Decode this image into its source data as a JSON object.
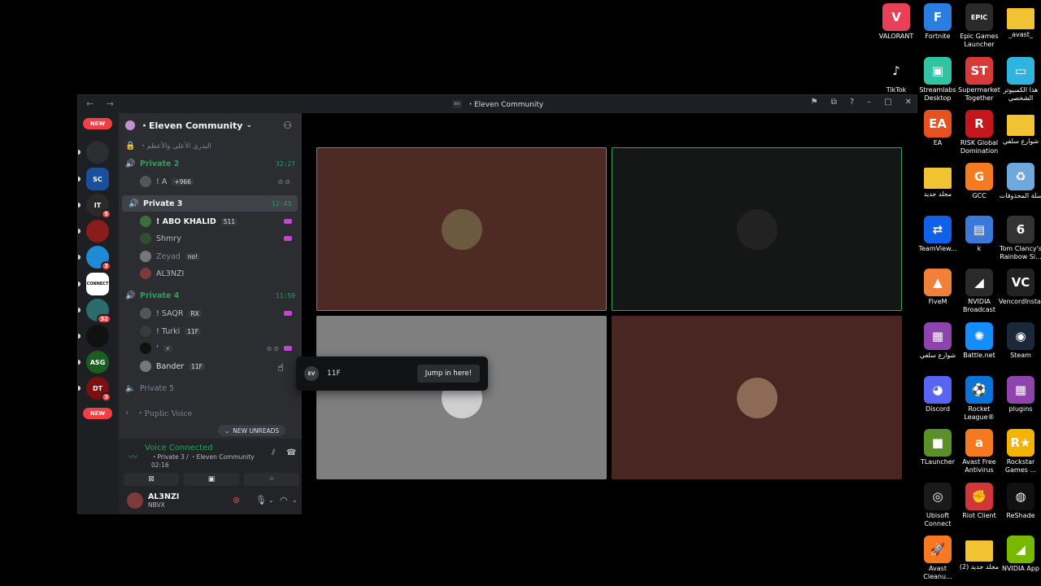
{
  "desktop": {
    "icons": [
      {
        "label": "VALORANT",
        "icon": "valorant-icon",
        "color": "#e84057",
        "glyph": "V"
      },
      {
        "label": "Fortnite",
        "icon": "fortnite-icon",
        "color": "#2a7de1",
        "glyph": "F"
      },
      {
        "label": "Epic Games Launcher",
        "icon": "epic-games-icon",
        "color": "#2a2a2a",
        "glyph": "EPIC"
      },
      {
        "label": "_avast_",
        "icon": "folder-icon",
        "color": "#f1c232",
        "glyph": ""
      },
      {
        "label": "TikTok",
        "icon": "tiktok-icon",
        "color": "#000000",
        "glyph": "♪"
      },
      {
        "label": "Streamlabs Desktop",
        "icon": "streamlabs-icon",
        "color": "#31c3a2",
        "glyph": "▣"
      },
      {
        "label": "Supermarket Together",
        "icon": "supermarket-icon",
        "color": "#d83a3a",
        "glyph": "ST"
      },
      {
        "label": "هذا الكمبيوتر الشخصي",
        "icon": "computer-icon",
        "color": "#2fb4e0",
        "glyph": "▭"
      },
      {
        "label": "EA",
        "icon": "ea-icon",
        "color": "#e85020",
        "glyph": "EA"
      },
      {
        "label": "RISK Global Domination",
        "icon": "risk-icon",
        "color": "#c4161c",
        "glyph": "R"
      },
      {
        "label": "شوارع سلفي",
        "icon": "folder-icon",
        "color": "#f1c232",
        "glyph": ""
      },
      {
        "label": "مجلد جديد",
        "icon": "folder-icon",
        "color": "#f1c232",
        "glyph": ""
      },
      {
        "label": "GCC",
        "icon": "gcc-icon",
        "color": "#f47b20",
        "glyph": "G"
      },
      {
        "label": "سلة المحذوفات",
        "icon": "recycle-bin-icon",
        "color": "#6fa8dc",
        "glyph": "♻"
      },
      {
        "label": "TeamView...",
        "icon": "teamviewer-icon",
        "color": "#1061e8",
        "glyph": "⇄"
      },
      {
        "label": "k",
        "icon": "file-icon",
        "color": "#3c78d8",
        "glyph": "▤"
      },
      {
        "label": "Tom Clancy's Rainbow Si...",
        "icon": "rainbow-six-icon",
        "color": "#333333",
        "glyph": "6"
      },
      {
        "label": "FiveM",
        "icon": "fivem-icon",
        "color": "#f0803a",
        "glyph": "▲"
      },
      {
        "label": "NVIDIA Broadcast",
        "icon": "nvidia-broadcast-icon",
        "color": "#2a2a2a",
        "glyph": "◢"
      },
      {
        "label": "VencordInstal",
        "icon": "vencord-icon",
        "color": "#222222",
        "glyph": "VC"
      },
      {
        "label": "شوارع سلفي",
        "icon": "winrar-icon",
        "color": "#8e44ad",
        "glyph": "▦"
      },
      {
        "label": "Battle.net",
        "icon": "battlenet-icon",
        "color": "#148eff",
        "glyph": "✺"
      },
      {
        "label": "Steam",
        "icon": "steam-icon",
        "color": "#1b2838",
        "glyph": "◉"
      },
      {
        "label": "Discord",
        "icon": "discord-icon",
        "color": "#5865f2",
        "glyph": "◕"
      },
      {
        "label": "Rocket League®",
        "icon": "rocket-league-icon",
        "color": "#0a74da",
        "glyph": "⚽"
      },
      {
        "label": "plugins",
        "icon": "winrar-icon",
        "color": "#8e44ad",
        "glyph": "▦"
      },
      {
        "label": "TLauncher",
        "icon": "tlauncher-icon",
        "color": "#5a8f29",
        "glyph": "■"
      },
      {
        "label": "Avast Free Antivirus",
        "icon": "avast-icon",
        "color": "#f47920",
        "glyph": "a"
      },
      {
        "label": "Rockstar Games ...",
        "icon": "rockstar-icon",
        "color": "#f5b301",
        "glyph": "R★"
      },
      {
        "label": "Ubisoft Connect",
        "icon": "ubisoft-icon",
        "color": "#1a1a1a",
        "glyph": "◎"
      },
      {
        "label": "Riot Client",
        "icon": "riot-icon",
        "color": "#d13639",
        "glyph": "✊"
      },
      {
        "label": "ReShade",
        "icon": "reshade-icon",
        "color": "#111111",
        "glyph": "◍"
      },
      {
        "label": "Avast Cleanu...",
        "icon": "avast-cleanup-icon",
        "color": "#f47920",
        "glyph": "🚀"
      },
      {
        "label": "مجلد جديد (2)",
        "icon": "folder-icon",
        "color": "#f1c232",
        "glyph": ""
      },
      {
        "label": "NVIDIA App",
        "icon": "nvidia-app-icon",
        "color": "#76b900",
        "glyph": "◢"
      }
    ]
  },
  "window": {
    "title": "・Eleven Community",
    "nav": "← →"
  },
  "rail": {
    "new_top": "NEW",
    "new_bottom": "NEW",
    "servers": [
      {
        "glyph": "",
        "color": "#2b2d31",
        "badge": ""
      },
      {
        "glyph": "SC",
        "color": "#1a4fa0",
        "badge": ""
      },
      {
        "glyph": "IT",
        "color": "#2a2a2a",
        "badge": "5"
      },
      {
        "glyph": "",
        "color": "#8a1c1c",
        "badge": ""
      },
      {
        "glyph": "",
        "color": "#1f8ad6",
        "badge": "3"
      },
      {
        "glyph": "CONNECT",
        "color": "#ffffff",
        "badge": ""
      },
      {
        "glyph": "",
        "color": "#2a6b6e",
        "badge": "32"
      },
      {
        "glyph": "",
        "color": "#111111",
        "badge": ""
      },
      {
        "glyph": "ASG",
        "color": "#1b5e20",
        "badge": ""
      },
      {
        "glyph": "DT",
        "color": "#7a1010",
        "badge": "3"
      }
    ]
  },
  "sidebar": {
    "server_name": "・Eleven Community",
    "locked_channel": "・البدري الأعلى والأعظم",
    "channels": [
      {
        "name": "Private 2",
        "timer": "32:27"
      },
      {
        "name": "Private 3",
        "timer": "12:43"
      },
      {
        "name": "Private 4",
        "timer": "11:59"
      },
      {
        "name": "Private 5",
        "timer": ""
      }
    ],
    "users_p2": [
      {
        "name": "! A",
        "tag": "+966",
        "color": "#555555"
      }
    ],
    "users_p3": [
      {
        "name": "! ABO KHALID",
        "tag": "511",
        "color": "#3c6e3c"
      },
      {
        "name": "Shmry",
        "tag": "",
        "color": "#2f4f2f"
      },
      {
        "name": "Zeyad",
        "tag": "no!",
        "color": "#777777"
      },
      {
        "name": "AL3NZI",
        "tag": "",
        "color": "#7c3a3a"
      }
    ],
    "users_p4": [
      {
        "name": "! SAQR",
        "tag": "RX",
        "color": "#555555"
      },
      {
        "name": "! Turki",
        "tag": "11F",
        "color": "#3a3a3a"
      },
      {
        "name": "'",
        "tag": "⚡",
        "color": "#111111"
      },
      {
        "name": "Bander",
        "tag": "11F",
        "color": "#777777"
      }
    ],
    "public_voice": "・Puplic Voice",
    "new_unreads": "NEW UNREADS"
  },
  "voice": {
    "status": "Voice Connected",
    "channel": "・Private 3 / ・Eleven Community",
    "elapsed": "02:16"
  },
  "user": {
    "name": "AL3NZI",
    "status": "NBVX"
  },
  "stage": {
    "tiles": [
      {
        "bg": "#4d2a24",
        "border": "#3ba55d",
        "avatar": "#6b5a40"
      },
      {
        "bg": "#141716",
        "border": "#3ba55d",
        "avatar": "#222222"
      },
      {
        "bg": "#7f7f7f",
        "border": "",
        "avatar": "#cfcfcf"
      },
      {
        "bg": "#4a2622",
        "border": "",
        "avatar": "#8c6a55"
      }
    ]
  },
  "tooltip": {
    "name": "11F",
    "button": "Jump in here!",
    "icon_text": "EV"
  }
}
